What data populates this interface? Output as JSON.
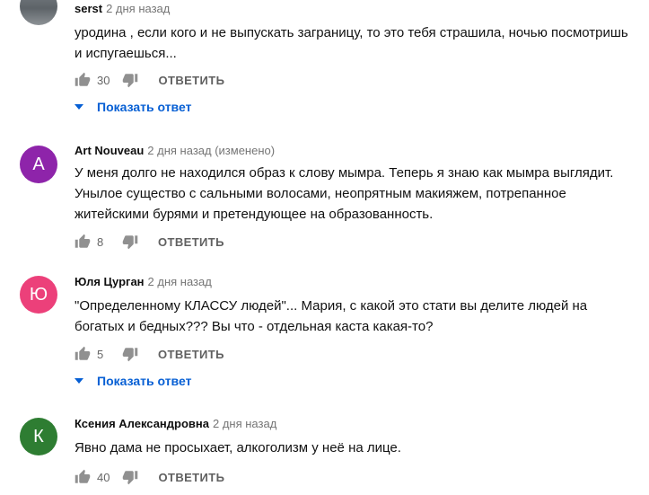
{
  "comments": [
    {
      "author": "serst",
      "meta": "2 дня назад",
      "avatar_letter": "",
      "text": "уродина , если кого и не выпускать заграницу, то это тебя страшила, ночью посмотришь и испугаешься...",
      "likes": "30",
      "reply_label": "ОТВЕТИТЬ",
      "show_replies_label": "Показать ответ"
    },
    {
      "author": "Art Nouveau",
      "meta": "2 дня назад (изменено)",
      "avatar_letter": "A",
      "avatar_color": "#8e24aa",
      "text": "У меня долго не находился образ к слову мымра. Теперь я знаю как мымра выглядит. Унылое существо с сальными волосами, неопрятным макияжем, потрепанное житейскими бурями и претендующее на образованность.",
      "likes": "8",
      "reply_label": "ОТВЕТИТЬ"
    },
    {
      "author": "Юля Цурган",
      "meta": "2 дня назад",
      "avatar_letter": "Ю",
      "avatar_color": "#ec407a",
      "text": "\"Определенному КЛАССУ людей\"... Мария, с какой это стати вы делите людей на богатых и бедных??? Вы что - отдельная каста какая-то?",
      "likes": "5",
      "reply_label": "ОТВЕТИТЬ",
      "show_replies_label": "Показать ответ"
    },
    {
      "author": "Ксения Александровна",
      "meta": "2 дня назад",
      "avatar_letter": "К",
      "avatar_color": "#2e7d32",
      "text": "Явно дама не просыхает, алкоголизм у неё на лице.",
      "likes": "40",
      "reply_label": "ОТВЕТИТЬ"
    }
  ],
  "colors": {
    "link": "#065fd4",
    "meta": "#757575",
    "icon": "#909090"
  }
}
